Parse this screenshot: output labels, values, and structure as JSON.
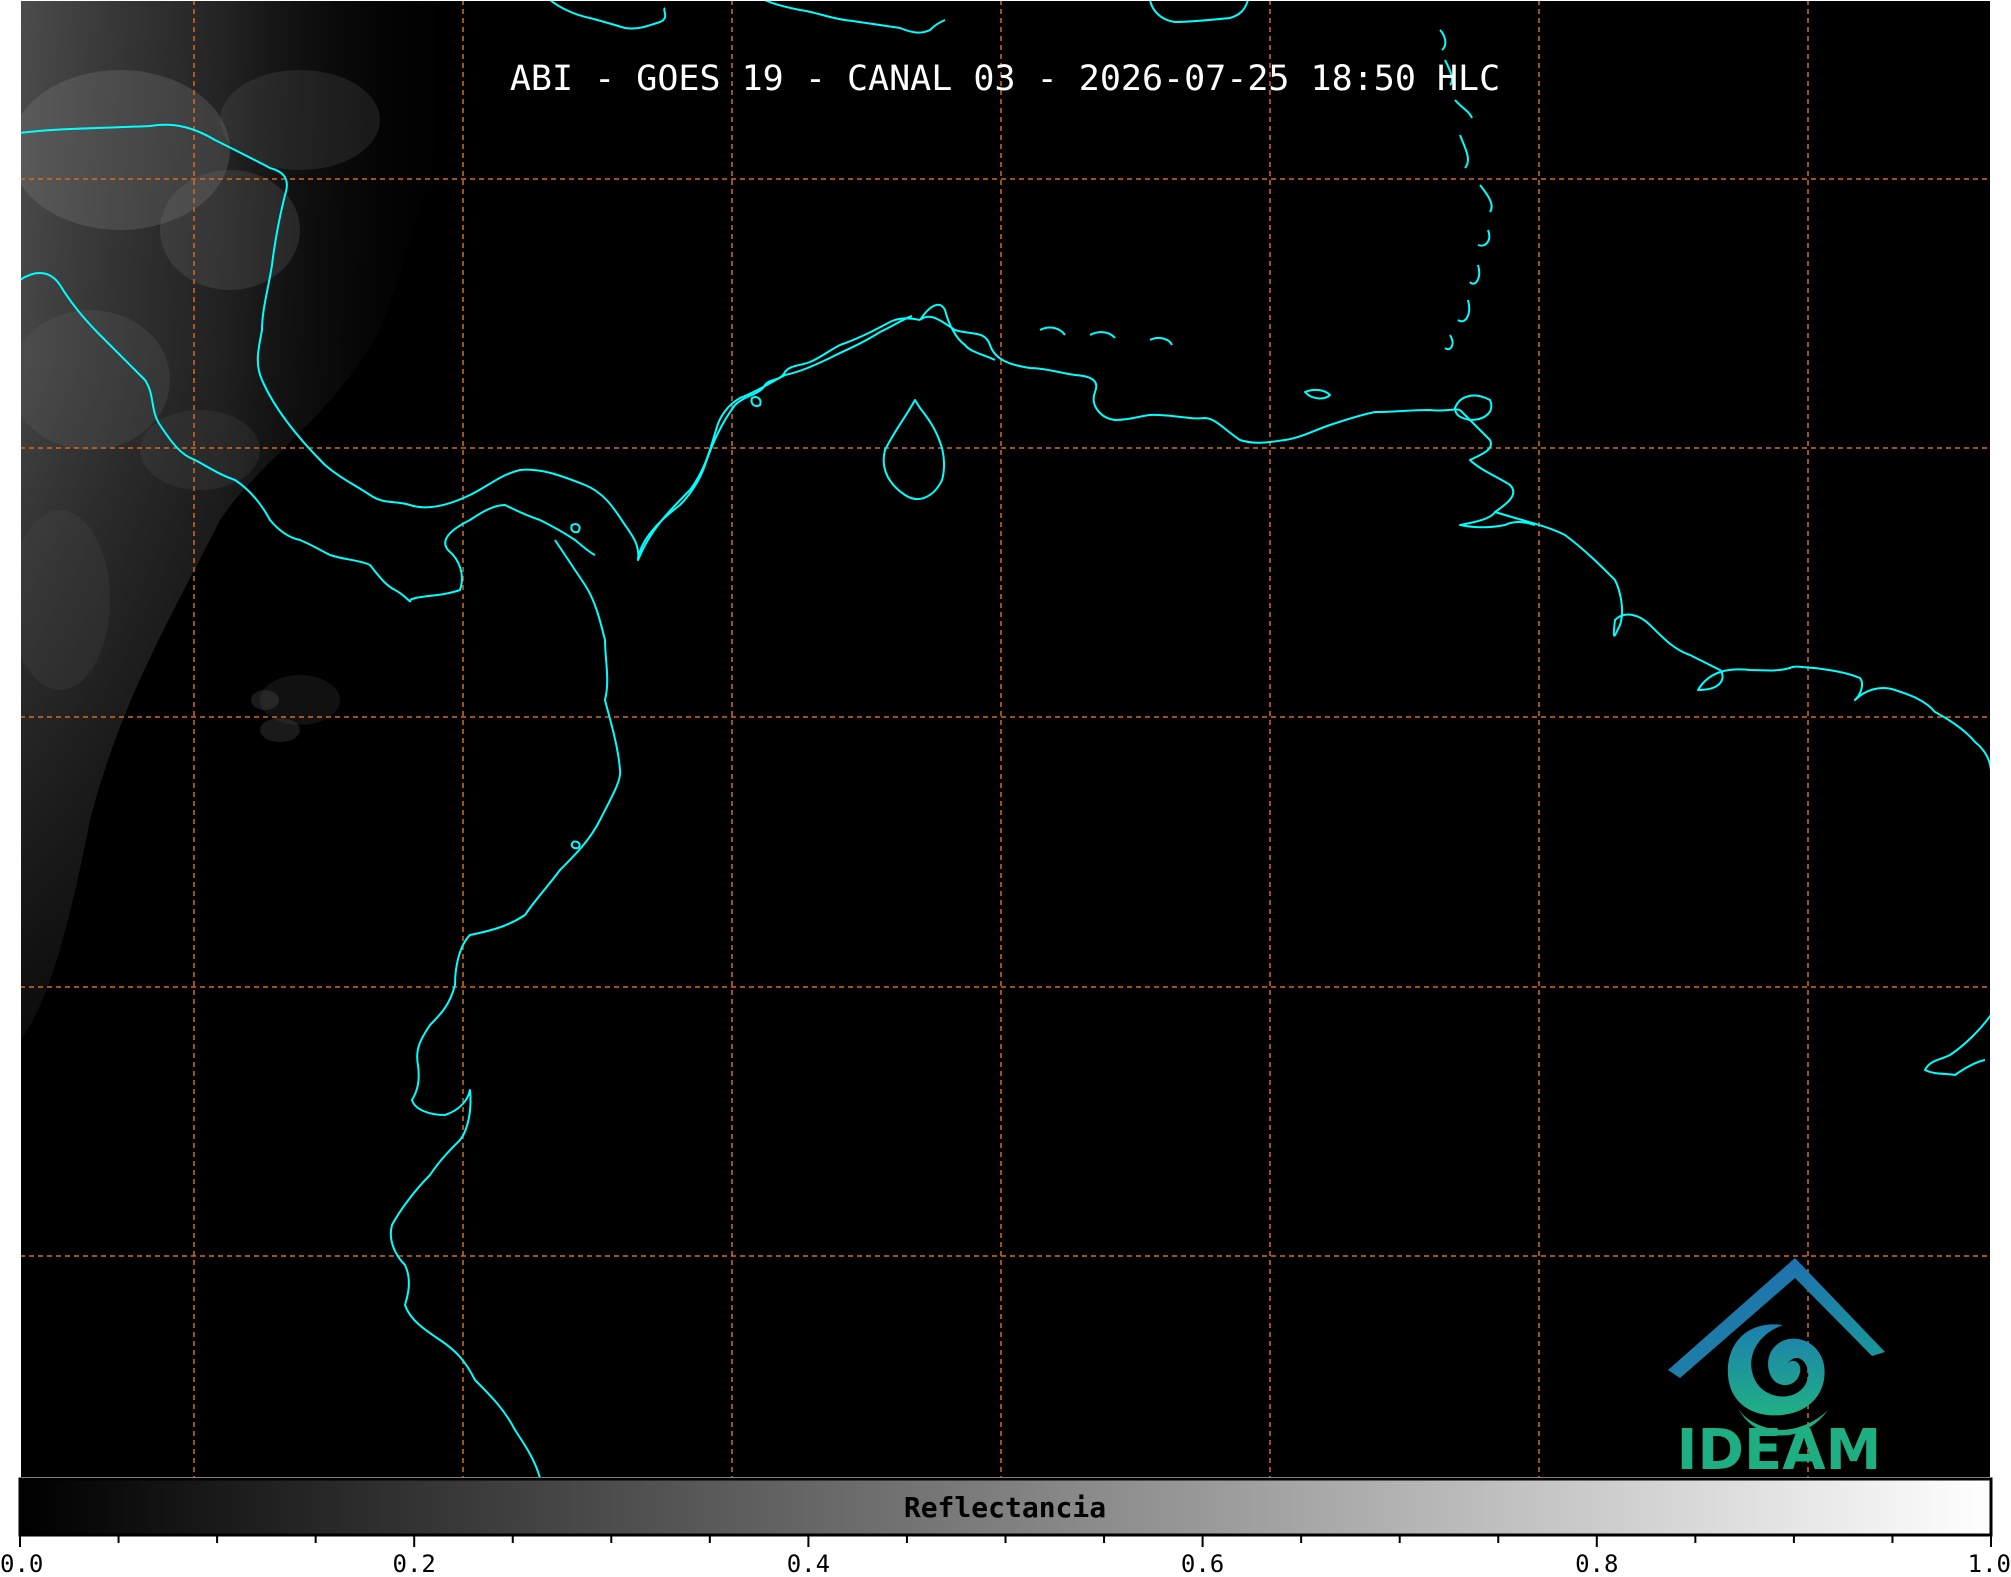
{
  "title": "ABI - GOES 19 - CANAL 03 - 2026-07-25 18:50 HLC",
  "colorbar": {
    "label": "Reflectancia",
    "range": [
      0.0,
      1.0
    ],
    "major_ticks": [
      "0.0",
      "0.2",
      "0.4",
      "0.6",
      "0.8",
      "1.0"
    ],
    "minor_tick_step": 0.05,
    "colors": {
      "low": "#000000",
      "high": "#ffffff"
    }
  },
  "logo": {
    "text": "IDEAM",
    "icon": "ideam-mountain-spiral-icon",
    "colors": {
      "roof": "#2a6fb5",
      "spiral": "#1a9d96",
      "text": "#1fae82"
    }
  },
  "map": {
    "background": "#000000",
    "coastline_color": "#00ffff",
    "grid_color": "#d86a1e",
    "gridlines": true,
    "gridline_style": "dashed",
    "cloud_region": "left (Pacific / Central America)"
  }
}
